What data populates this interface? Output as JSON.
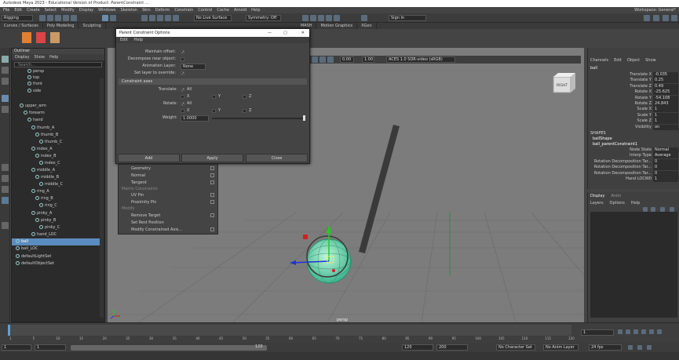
{
  "app": {
    "title": "Autodesk Maya 2023 - Educational Version of Product: ParentConstraint ...",
    "workspace_label": "Workspace:",
    "workspace_value": "General*"
  },
  "menubar": [
    "File",
    "Edit",
    "Create",
    "Select",
    "Modify",
    "Display",
    "Windows",
    "Skeleton",
    "Skin",
    "Deform",
    "Constrain",
    "Control",
    "Cache",
    "Arnold",
    "Help"
  ],
  "status": {
    "mode": "Rigging",
    "surface": "No Live Surface",
    "symmetry": "Symmetry: Off",
    "signin": "Sign In"
  },
  "shelf_tabs": [
    "Curves / Surfaces",
    "Poly Modeling",
    "Sculpting",
    "MASH",
    "Motion Graphics",
    "XGen"
  ],
  "outliner": {
    "title": "Outliner",
    "menu": [
      "Display",
      "Show",
      "Help"
    ],
    "search_placeholder": "Search...",
    "rows": [
      "persp",
      "top",
      "front",
      "side",
      "upper_arm",
      "forearm",
      "hand",
      "thumb_A",
      "thumb_B",
      "thumb_C",
      "index_A",
      "index_B",
      "index_C",
      "middle_A",
      "middle_B",
      "middle_C",
      "ring_A",
      "ring_B",
      "ring_C",
      "pinky_A",
      "pinky_B",
      "pinky_C",
      "hand_LOC",
      "ball",
      "ball_LOC",
      "defaultLightSet",
      "defaultObjectSet"
    ],
    "selected": "ball"
  },
  "viewport": {
    "frame_start": "0.00",
    "zoom": "1.00",
    "colorspace": "ACES 1.0 SDR-video (sRGB)",
    "cam_label": "persp",
    "view_cube": "RIGHT"
  },
  "dialog": {
    "title": "Parent Constraint Options",
    "menu": [
      "Edit",
      "Help"
    ],
    "maintain_offset": "Maintain offset:",
    "decompose": "Decompose near object:",
    "anim_layer": "Animation Layer:",
    "anim_layer_value": "None",
    "set_layer": "Set layer to override:",
    "section": "Constraint axes",
    "translate": "Translate:",
    "rotate": "Rotate:",
    "all": "All",
    "x": "X",
    "y": "Y",
    "z": "Z",
    "weight": "Weight:",
    "weight_value": "1.0000",
    "buttons": [
      "Add",
      "Apply",
      "Close"
    ]
  },
  "submenu": {
    "items": [
      "Geometry",
      "Normal",
      "Tangent",
      "Matrix Constraints",
      "UV Pin",
      "Proximity Pin",
      "Modify",
      "Remove Target",
      "Set Rest Position",
      "Modify Constrained Axis..."
    ]
  },
  "channel_box": {
    "menu": [
      "Channels",
      "Edit",
      "Object",
      "Show"
    ],
    "object": "ball",
    "attrs": [
      [
        "Translate X",
        "-0.035"
      ],
      [
        "Translate Y",
        "0.25"
      ],
      [
        "Translate Z",
        "0.49"
      ],
      [
        "Rotate X",
        "-25.625"
      ],
      [
        "Rotate Y",
        "-54.108"
      ],
      [
        "Rotate Z",
        "24.843"
      ],
      [
        "Scale X",
        "1"
      ],
      [
        "Scale Y",
        "1"
      ],
      [
        "Scale Z",
        "1"
      ],
      [
        "Visibility",
        "on"
      ]
    ],
    "shapes_label": "SHAPES",
    "shape": "ballShape",
    "constraint": "ball_parentConstraint1",
    "constraint_attrs": [
      [
        "Node State",
        "Normal"
      ],
      [
        "Interp Type",
        "Average"
      ],
      [
        "Rotation Decomposition Tar...",
        "0"
      ],
      [
        "Rotation Decomposition Tar...",
        "0"
      ],
      [
        "Rotation Decomposition Tar...",
        "0"
      ],
      [
        "Hand LOCW0",
        "1"
      ]
    ]
  },
  "layers": {
    "tabs": [
      "Display",
      "Anim"
    ],
    "menu": [
      "Layers",
      "Options",
      "Help"
    ]
  },
  "timeline": {
    "ticks": [
      "1",
      "5",
      "10",
      "15",
      "20",
      "25",
      "30",
      "35",
      "40",
      "45",
      "50",
      "55",
      "60",
      "65",
      "70",
      "75",
      "80",
      "85",
      "90",
      "95",
      "100",
      "105",
      "110",
      "115",
      "120"
    ],
    "current": "1"
  },
  "range": {
    "start": "1",
    "start2": "1",
    "end": "120",
    "end2": "120",
    "end3": "200",
    "char_set": "No Character Set",
    "anim_layer": "No Anim Layer",
    "fps": "24 fps"
  }
}
